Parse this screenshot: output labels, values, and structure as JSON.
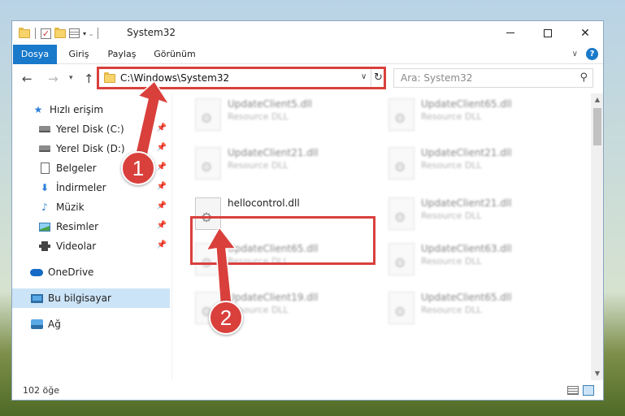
{
  "window": {
    "title": "System32",
    "controls": {
      "minimize": "—",
      "maximize": "☐",
      "close": "✕"
    }
  },
  "ribbon": {
    "tabs": [
      {
        "label": "Dosya"
      },
      {
        "label": "Giriş"
      },
      {
        "label": "Paylaş"
      },
      {
        "label": "Görünüm"
      }
    ],
    "help": "?"
  },
  "nav": {
    "address": "C:\\Windows\\System32",
    "search_placeholder": "Ara: System32"
  },
  "sidebar": {
    "items": [
      {
        "label": "Hızlı erişim",
        "icon": "star-icon"
      },
      {
        "label": "Yerel Disk (C:)",
        "icon": "disk-icon",
        "pinned": true
      },
      {
        "label": "Yerel Disk (D:)",
        "icon": "disk-icon",
        "pinned": true
      },
      {
        "label": "Belgeler",
        "icon": "document-icon",
        "pinned": true
      },
      {
        "label": "İndirmeler",
        "icon": "download-icon",
        "pinned": true
      },
      {
        "label": "Müzik",
        "icon": "music-icon",
        "pinned": true
      },
      {
        "label": "Resimler",
        "icon": "pictures-icon",
        "pinned": true
      },
      {
        "label": "Videolar",
        "icon": "videos-icon",
        "pinned": true
      },
      {
        "label": "OneDrive",
        "icon": "cloud-icon"
      },
      {
        "label": "Bu bilgisayar",
        "icon": "computer-icon",
        "selected": true
      },
      {
        "label": "Ağ",
        "icon": "network-icon"
      }
    ]
  },
  "files": [
    {
      "name": "UpdateClient5.dll",
      "type": "Resource DLL"
    },
    {
      "name": "UpdateClient65.dll",
      "type": "Resource DLL"
    },
    {
      "name": "UpdateClient21.dll",
      "type": "Resource DLL"
    },
    {
      "name": "UpdateClient21.dll",
      "type": "Resource DLL"
    },
    {
      "name": "hellocontrol.dll",
      "type": ""
    },
    {
      "name": "UpdateClient21.dll",
      "type": "Resource DLL"
    },
    {
      "name": "UpdateClient65.dll",
      "type": "Resource DLL"
    },
    {
      "name": "UpdateClient63.dll",
      "type": "Resource DLL"
    },
    {
      "name": "UpdateClient19.dll",
      "type": "Resource DLL"
    },
    {
      "name": "UpdateClient65.dll",
      "type": "Resource DLL"
    }
  ],
  "status": {
    "item_count": "102 öğe"
  },
  "annotations": {
    "step1": "1",
    "step2": "2",
    "color": "#d9403c"
  }
}
